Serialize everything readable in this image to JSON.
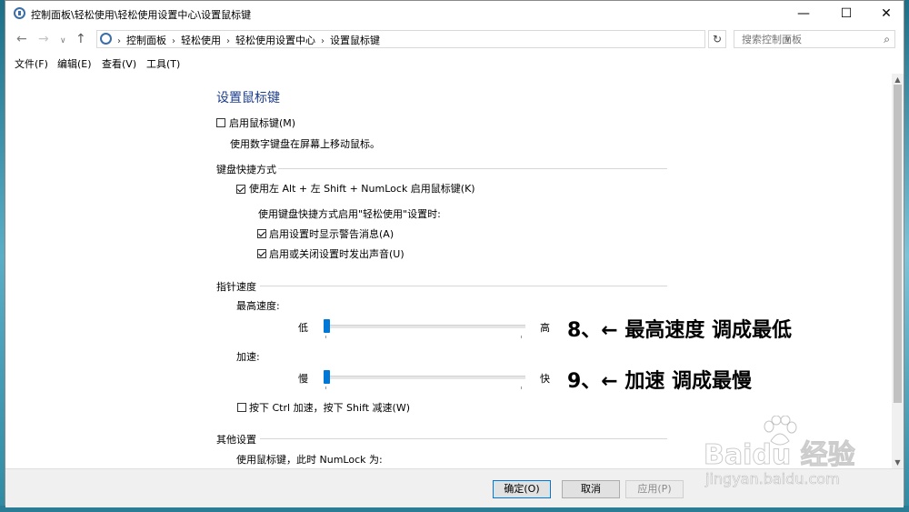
{
  "window": {
    "title": "控制面板\\轻松使用\\轻松使用设置中心\\设置鼠标键",
    "min_icon": "—",
    "max_icon": "☐",
    "close_icon": "✕"
  },
  "address": {
    "crumbs": [
      "控制面板",
      "轻松使用",
      "轻松使用设置中心",
      "设置鼠标键"
    ],
    "search_placeholder": "搜索控制面板"
  },
  "menu": [
    "文件(F)",
    "编辑(E)",
    "查看(V)",
    "工具(T)"
  ],
  "page": {
    "title": "设置鼠标键",
    "enable_mousekeys": {
      "label": "启用鼠标键(M)",
      "checked": false
    },
    "enable_desc": "使用数字键盘在屏幕上移动鼠标。",
    "keyboard_shortcut": {
      "header": "键盘快捷方式",
      "alt_shift_numlock": {
        "label": "使用左 Alt + 左 Shift + NumLock 启用鼠标键(K)",
        "checked": true
      },
      "when_enabled": "使用键盘快捷方式启用\"轻松使用\"设置时:",
      "show_warning": {
        "label": "启用设置时显示警告消息(A)",
        "checked": true
      },
      "make_sound": {
        "label": "启用或关闭设置时发出声音(U)",
        "checked": true
      }
    },
    "pointer_speed": {
      "header": "指针速度",
      "top_speed": {
        "label": "最高速度:",
        "low": "低",
        "high": "高",
        "value_fraction": 0.0
      },
      "acceleration": {
        "label": "加速:",
        "low": "慢",
        "high": "快",
        "value_fraction": 0.0
      },
      "ctrl_shift": {
        "label": "按下 Ctrl 加速，按下 Shift 减速(W)",
        "checked": false
      }
    },
    "other": {
      "header": "其他设置",
      "numlock_line": "使用鼠标键，此时 NumLock 为:"
    }
  },
  "annotations": {
    "note8": "8、←   最高速度 调成最低",
    "note9": "9、←   加速 调成最慢"
  },
  "buttons": {
    "ok": "确定(O)",
    "cancel": "取消",
    "apply": "应用(P)"
  },
  "watermark": {
    "brand": "Baidu 经验",
    "url": "jingyan.baidu.com"
  },
  "colors": {
    "accent": "#0078d7",
    "title_blue": "#1e3f8e"
  }
}
